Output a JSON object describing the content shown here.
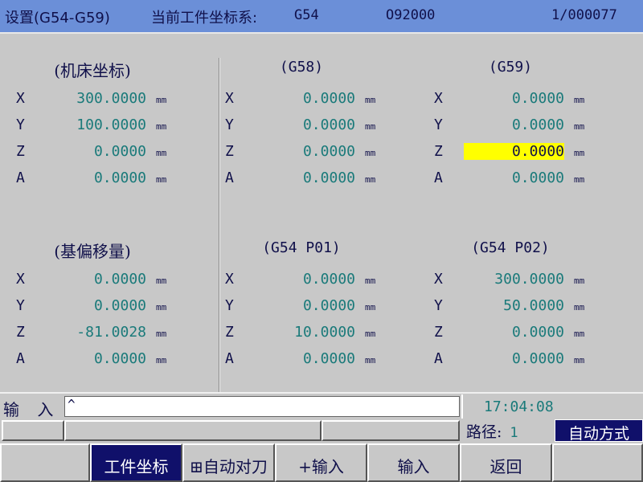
{
  "title": {
    "screen": "设置(G54-G59)",
    "coord_label": "当前工件坐标系:",
    "coord_value": "G54",
    "program": "O92000",
    "counter": "1/000077"
  },
  "unit": "mm",
  "blocks": {
    "machine": {
      "heading": "(机床坐标)",
      "rows": [
        {
          "axis": "X",
          "value": "300.0000"
        },
        {
          "axis": "Y",
          "value": "100.0000"
        },
        {
          "axis": "Z",
          "value": "0.0000"
        },
        {
          "axis": "A",
          "value": "0.0000"
        }
      ]
    },
    "g58": {
      "heading": "(G58)",
      "rows": [
        {
          "axis": "X",
          "value": "0.0000"
        },
        {
          "axis": "Y",
          "value": "0.0000"
        },
        {
          "axis": "Z",
          "value": "0.0000"
        },
        {
          "axis": "A",
          "value": "0.0000"
        }
      ]
    },
    "g59": {
      "heading": "(G59)",
      "rows": [
        {
          "axis": "X",
          "value": "0.0000"
        },
        {
          "axis": "Y",
          "value": "0.0000"
        },
        {
          "axis": "Z",
          "value": "0.0000"
        },
        {
          "axis": "A",
          "value": "0.0000"
        }
      ]
    },
    "offset": {
      "heading": "(基偏移量)",
      "rows": [
        {
          "axis": "X",
          "value": "0.0000"
        },
        {
          "axis": "Y",
          "value": "0.0000"
        },
        {
          "axis": "Z",
          "value": "-81.0028"
        },
        {
          "axis": "A",
          "value": "0.0000"
        }
      ]
    },
    "p01": {
      "heading": "(G54 P01)",
      "rows": [
        {
          "axis": "X",
          "value": "0.0000"
        },
        {
          "axis": "Y",
          "value": "0.0000"
        },
        {
          "axis": "Z",
          "value": "10.0000"
        },
        {
          "axis": "A",
          "value": "0.0000"
        }
      ]
    },
    "p02": {
      "heading": "(G54 P02)",
      "rows": [
        {
          "axis": "X",
          "value": "300.0000"
        },
        {
          "axis": "Y",
          "value": "50.0000"
        },
        {
          "axis": "Z",
          "value": "0.0000"
        },
        {
          "axis": "A",
          "value": "0.0000"
        }
      ]
    }
  },
  "input": {
    "label": "输 入",
    "value": "^"
  },
  "clock": "17:04:08",
  "path": {
    "label": "路径:",
    "value": "1"
  },
  "mode": "自动方式",
  "softkeys": [
    "工件坐标",
    "⊞自动对刀",
    "+输入",
    "输入",
    "返回"
  ],
  "colors": {
    "titlebar": "#6b8fd8",
    "highlight": "#ffff00",
    "active_key": "#10106a",
    "value_text": "#1a7a7a"
  }
}
